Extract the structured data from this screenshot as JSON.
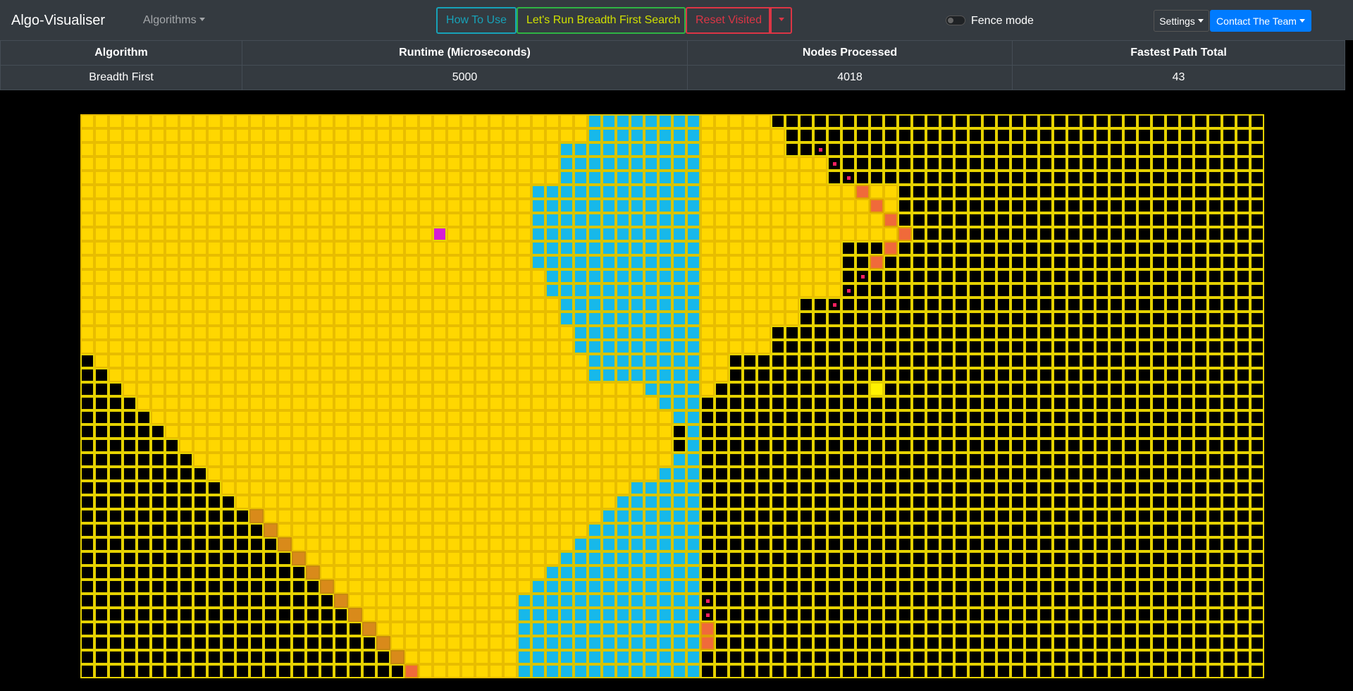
{
  "navbar": {
    "brand": "Algo-Visualiser",
    "algorithms_label": "Algorithms",
    "how_to_use_label": "How To Use",
    "run_label": "Let's Run Breadth First Search",
    "reset_label": "Reset Visited",
    "fence_mode_label": "Fence mode",
    "settings_label": "Settings",
    "contact_label": "Contact The Team"
  },
  "stats_table": {
    "headers": [
      "Algorithm",
      "Runtime (Microseconds)",
      "Nodes Processed",
      "Fastest Path Total"
    ],
    "row": [
      "Breadth First",
      "5000",
      "4018",
      "43"
    ]
  },
  "grid": {
    "rows": 40,
    "cols": 84,
    "colors": {
      "unvisited": "#000000",
      "visited": "#ffd700",
      "wall": "#17b8ea",
      "start": "#d61cd6",
      "target": "#fff200",
      "path": "#d98a1a",
      "border": "#e6d200"
    }
  }
}
